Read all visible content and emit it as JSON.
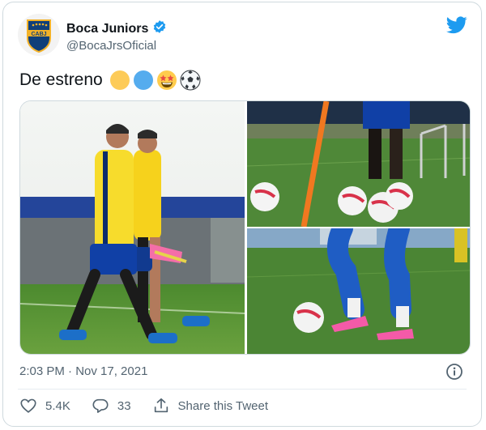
{
  "tweet": {
    "display_name": "Boca Juniors",
    "handle": "@BocaJrsOficial",
    "text": "De estreno",
    "timestamp": "2:03 PM · Nov 17, 2021",
    "avatar_text": "CABJ"
  },
  "emojis": [
    "yellow-circle",
    "blue-circle",
    "star-struck-face",
    "soccer-ball"
  ],
  "actions": {
    "like_count": "5.4K",
    "reply_count": "33",
    "share_label": "Share this Tweet"
  },
  "colors": {
    "twitter_blue": "#1d9bf0",
    "text_primary": "#0f1419",
    "text_secondary": "#536471",
    "boca_blue": "#103f79",
    "boca_gold": "#f3b229"
  }
}
